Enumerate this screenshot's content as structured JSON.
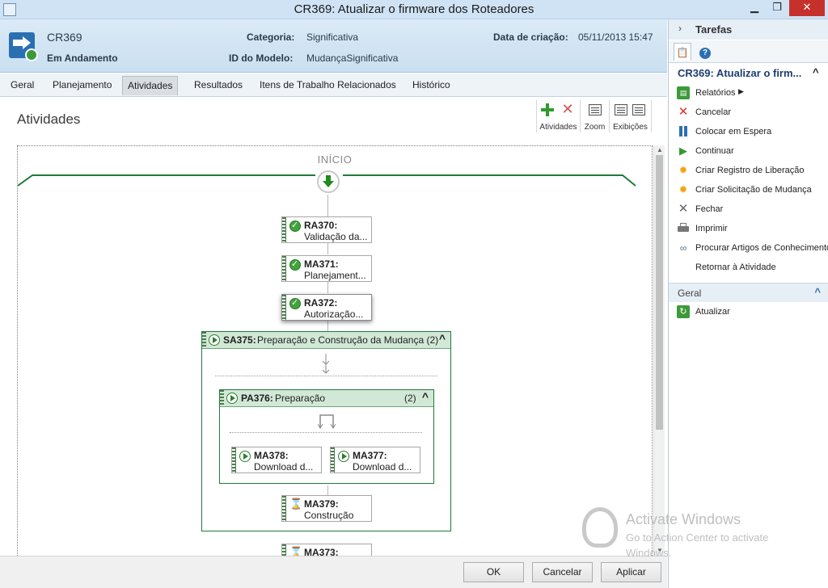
{
  "window": {
    "title": "CR369: Atualizar o firmware dos Roteadores"
  },
  "header": {
    "id": "CR369",
    "status": "Em Andamento",
    "categoria_label": "Categoria:",
    "categoria_value": "Significativa",
    "modelo_label": "ID do Modelo:",
    "modelo_value": "MudançaSignificativa",
    "data_label": "Data de criação:",
    "data_value": "05/11/2013 15:47"
  },
  "tabs": [
    {
      "label": "Geral"
    },
    {
      "label": "Planejamento"
    },
    {
      "label": "Atividades"
    },
    {
      "label": "Resultados"
    },
    {
      "label": "Itens de Trabalho Relacionados"
    },
    {
      "label": "Histórico"
    }
  ],
  "active_tab": "Atividades",
  "content": {
    "title": "Atividades",
    "toolbar": {
      "atividades": "Atividades",
      "zoom": "Zoom",
      "exibicoes": "Exibições"
    },
    "start_label": "INÍCIO"
  },
  "workflow": {
    "nodes": [
      {
        "id": "RA370:",
        "text": "Validação da...",
        "status": "completed"
      },
      {
        "id": "MA371:",
        "text": "Planejament...",
        "status": "completed"
      },
      {
        "id": "RA372:",
        "text": "Autorização...",
        "status": "completed"
      },
      {
        "id": "MA378:",
        "text": "Download d...",
        "status": "in-progress"
      },
      {
        "id": "MA377:",
        "text": "Download d...",
        "status": "in-progress"
      },
      {
        "id": "MA379:",
        "text": "Construção",
        "status": "pending"
      },
      {
        "id": "MA373:",
        "text": "",
        "status": "pending"
      }
    ],
    "groups": [
      {
        "id": "SA375:",
        "title": "Preparação e Construção da Mudança (2)",
        "status": "in-progress"
      },
      {
        "id": "PA376:",
        "title": "Preparação",
        "count": "(2)",
        "status": "in-progress"
      }
    ]
  },
  "buttons": {
    "ok": "OK",
    "cancelar": "Cancelar",
    "aplicar": "Aplicar"
  },
  "sidepanel": {
    "header": "Tarefas",
    "title": "CR369: Atualizar o firm...",
    "items": [
      {
        "label": "Relatórios",
        "icon": "report-icon"
      },
      {
        "label": "Cancelar",
        "icon": "cancel-icon"
      },
      {
        "label": "Colocar em Espera",
        "icon": "pause-icon"
      },
      {
        "label": "Continuar",
        "icon": "play-icon"
      },
      {
        "label": "Criar Registro de Liberação",
        "icon": "sun-icon"
      },
      {
        "label": "Criar Solicitação de Mudança",
        "icon": "sun-icon"
      },
      {
        "label": "Fechar",
        "icon": "close-icon"
      },
      {
        "label": "Imprimir",
        "icon": "print-icon"
      },
      {
        "label": "Procurar Artigos de Conhecimento",
        "icon": "link-icon"
      },
      {
        "label": "Retornar à Atividade",
        "icon": "none"
      }
    ],
    "geral_header": "Geral",
    "geral_items": [
      {
        "label": "Atualizar",
        "icon": "refresh-icon"
      }
    ]
  },
  "watermark": {
    "line1": "Activate Windows",
    "line2": "Go to Action Center to activate",
    "line3": "Windows."
  },
  "colors": {
    "accent": "#2b6fb3",
    "group_green": "#1f7a3a",
    "ok_green": "#41a33c"
  }
}
